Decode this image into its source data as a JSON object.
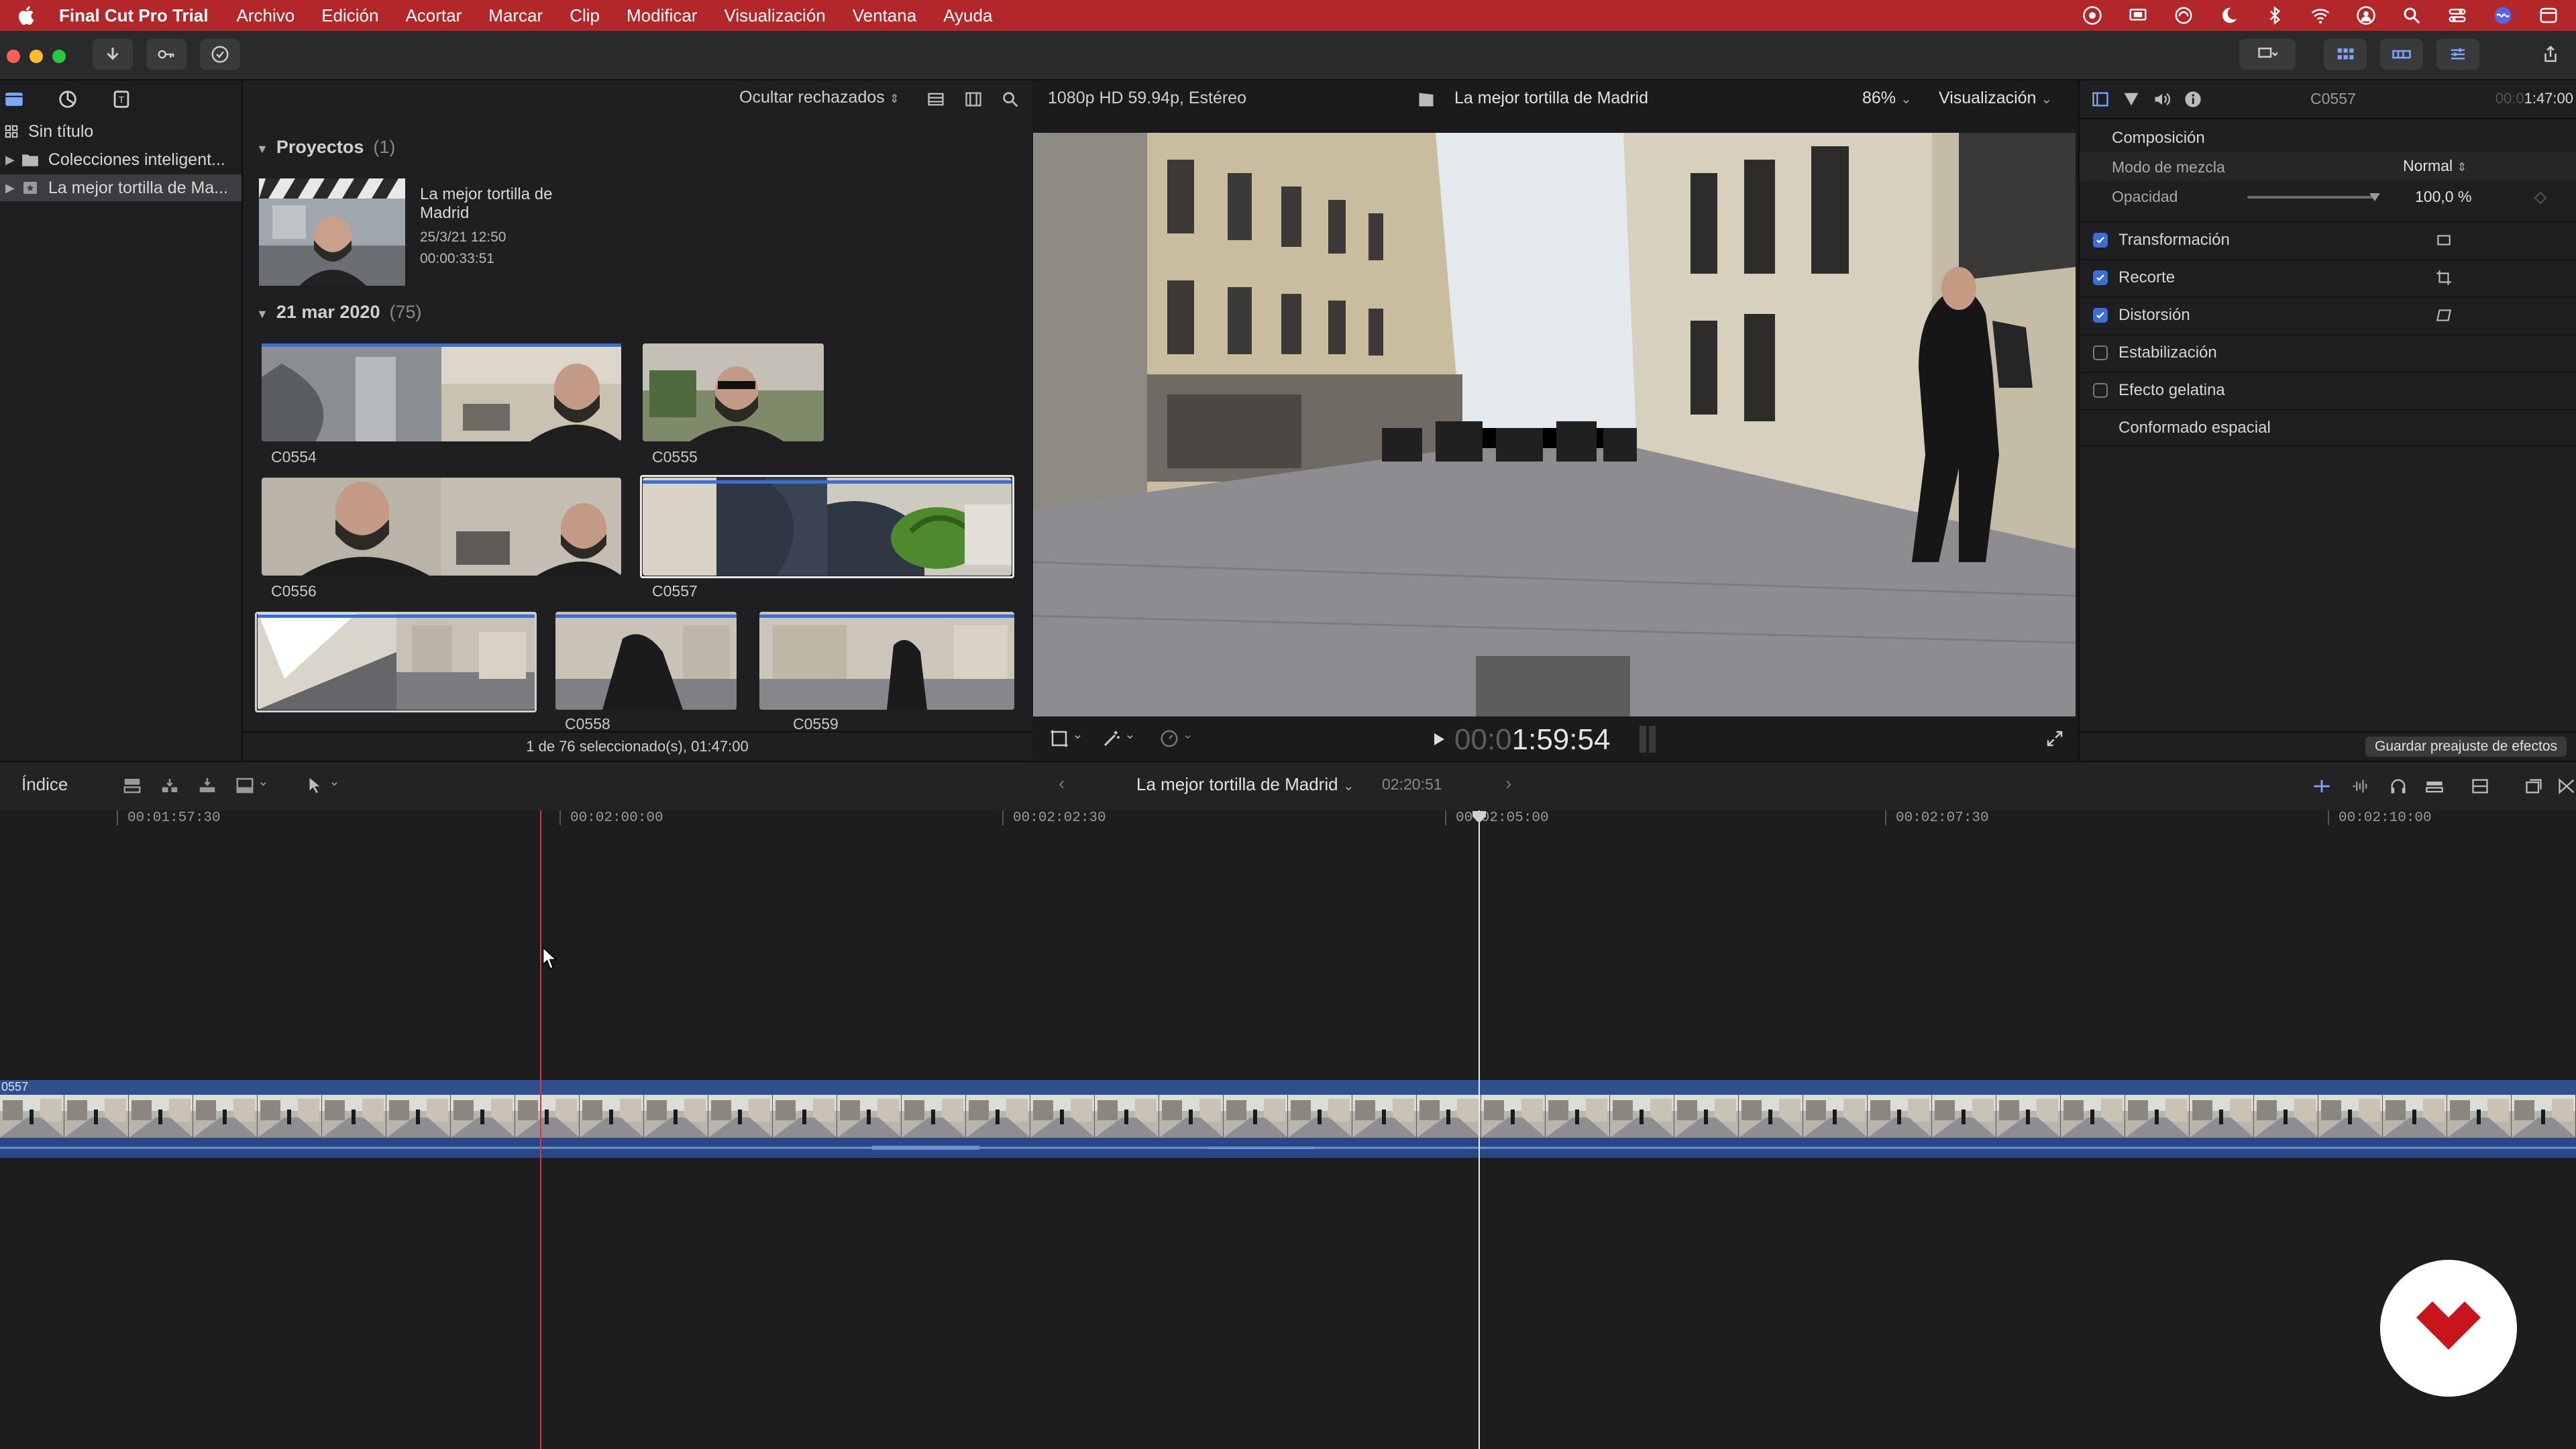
{
  "menubar": {
    "app_name": "Final Cut Pro Trial",
    "items": [
      "Archivo",
      "Edición",
      "Acortar",
      "Marcar",
      "Clip",
      "Modificar",
      "Visualización",
      "Ventana",
      "Ayuda"
    ]
  },
  "sidebar": {
    "items": [
      {
        "label": "Sin título"
      },
      {
        "label": "Colecciones inteligent..."
      },
      {
        "label": "La mejor tortilla de Ma..."
      }
    ]
  },
  "browser": {
    "filter_label": "Ocultar rechazados",
    "projects": {
      "title": "Proyectos",
      "count": "(1)",
      "item": {
        "name": "La mejor tortilla de Madrid",
        "date": "25/3/21 12:50",
        "duration": "00:00:33:51"
      }
    },
    "event": {
      "title": "21 mar 2020",
      "count": "(75)",
      "clips": [
        "C0554",
        "C0555",
        "C0556",
        "C0557",
        "C0558",
        "C0559"
      ]
    },
    "status": "1 de 76 seleccionado(s), 01:47:00"
  },
  "viewer": {
    "format": "1080p HD 59.94p, Estéreo",
    "project_title": "La mejor tortilla de Madrid",
    "zoom": "86%",
    "view_menu": "Visualización",
    "timecode_dim": "00:0",
    "timecode": "1:59:54"
  },
  "inspector": {
    "clip_name": "C0557",
    "timecode_dim": "00:0",
    "timecode": "1:47:00",
    "section": "Composición",
    "blend_label": "Modo de mezcla",
    "blend_value": "Normal",
    "opacity_label": "Opacidad",
    "opacity_value": "100,0",
    "opacity_unit": "%",
    "opacity_level": 1.0,
    "effects": [
      {
        "label": "Transformación",
        "checked": true
      },
      {
        "label": "Recorte",
        "checked": true
      },
      {
        "label": "Distorsión",
        "checked": true
      },
      {
        "label": "Estabilización",
        "checked": false
      },
      {
        "label": "Efecto gelatina",
        "checked": false
      },
      {
        "label": "Conformado espacial",
        "checked": null
      }
    ],
    "save_preset": "Guardar preajuste de efectos"
  },
  "timeline_bar": {
    "index_label": "Índice",
    "project_name": "La mejor tortilla de Madrid",
    "duration": "02:20:51"
  },
  "timeline": {
    "ruler": [
      "00:01:57:30",
      "00:02:00:00",
      "00:02:02:30",
      "00:02:05:00",
      "00:02:07:30",
      "00:02:10:00"
    ],
    "clip_name": "0557"
  },
  "colors": {
    "menubar": "#b3262a",
    "accent_blue": "#3c6fd6",
    "skimmer": "#d23b3b",
    "logo_red": "#c8151b"
  }
}
